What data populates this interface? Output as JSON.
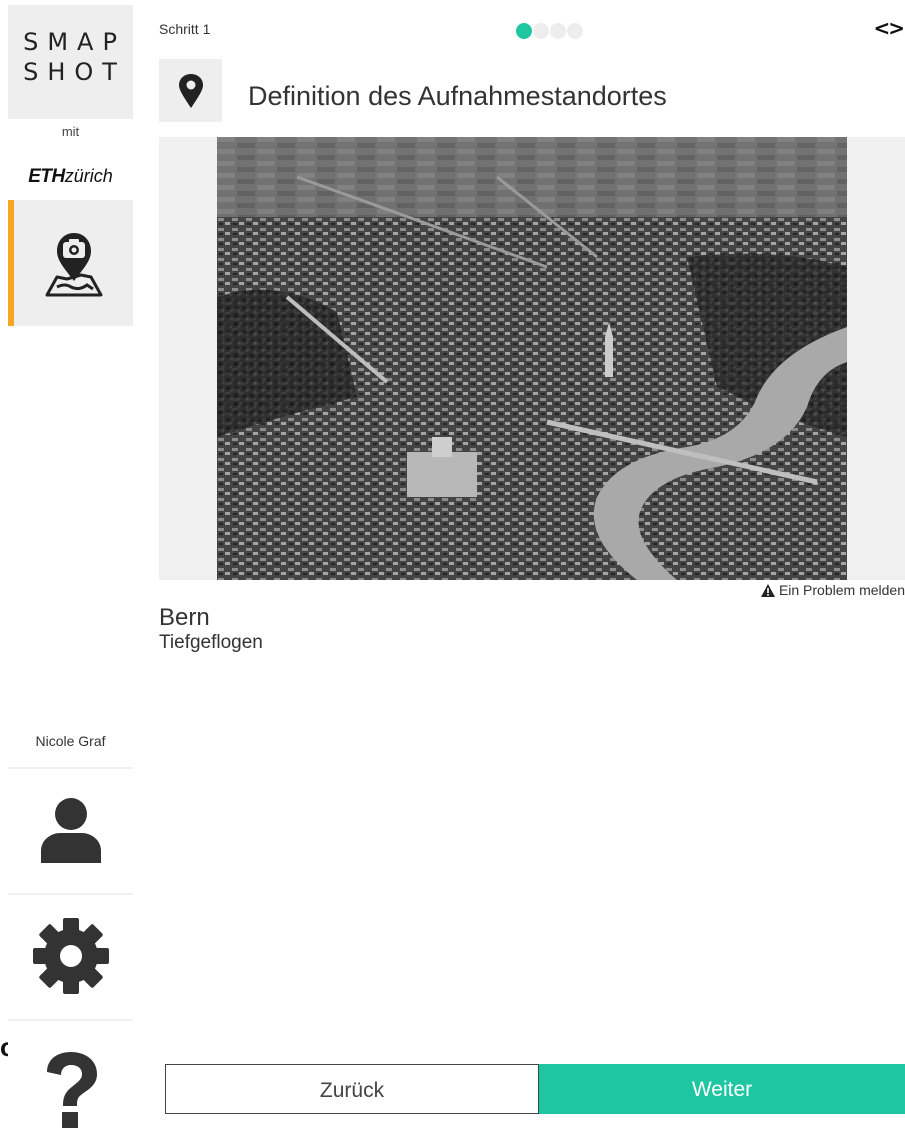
{
  "sidebar": {
    "logo_line1": "SMAP",
    "logo_line2": "SHOT",
    "mit": "mit",
    "eth_bold": "ETH",
    "eth_light": "zürich",
    "user_name": "Nicole Graf",
    "accent_color": "#f5a623",
    "icons": [
      "camera-map-icon",
      "user-icon",
      "gear-icon",
      "question-icon"
    ]
  },
  "header": {
    "step_label": "Schritt 1",
    "step_total": 4,
    "step_active": 1,
    "toggle_glyph": "<>",
    "title": "Definition des Aufnahmestandortes",
    "title_icon": "map-marker-icon"
  },
  "image": {
    "report_label": "Ein Problem melden",
    "title": "Bern",
    "subtitle": "Tiefgeflogen"
  },
  "footer": {
    "back_label": "Zurück",
    "next_label": "Weiter",
    "next_color": "#1fc6a2"
  },
  "edge_fragment": "o"
}
